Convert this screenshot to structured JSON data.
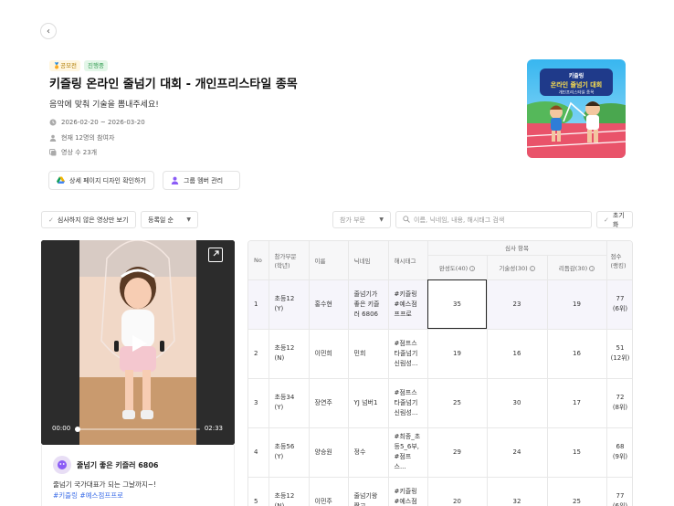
{
  "header": {
    "badges": [
      "공모전",
      "진행중"
    ],
    "title": "키즐링 온라인 줄넘기 대회 - 개인프리스타일 종목",
    "subtitle": "음악에 맞춰 기술을 뽐내주세요!",
    "period": "2026-02-20 ~ 2026-03-20",
    "participants": "현재 12명의 참여자",
    "video_count": "영상 수 23개",
    "btn_design": "상세 페이지 디자인 확인하기",
    "btn_group": "그룹 멤버 관리"
  },
  "thumbnail": {
    "line1": "키즐링",
    "line2": "온라인 줄넘기 대회",
    "line3": "개인프리스타일 종목"
  },
  "filters": {
    "unviewed": "심사하지 않은 영상만 보기",
    "sort": "등록일 순",
    "category": "참가 부문",
    "search_placeholder": "이름, 닉네임, 내용, 해시태그 검색",
    "reset": "초기화"
  },
  "player": {
    "current_time": "00:00",
    "duration": "02:33",
    "progress": 0
  },
  "video_card": {
    "name": "줄넘기 좋은 키즐러 6806",
    "description": "줄넘기 국가대표가 되는 그날까지~!",
    "tags": "#키즐링 #예스점프프로"
  },
  "table": {
    "headers": {
      "no": "No",
      "category": [
        "참가부문",
        "(학년)"
      ],
      "name": "이름",
      "nickname": "닉네임",
      "hashtag": "해시태그",
      "criteria_group": "심사 항목",
      "criteria": [
        "완성도(40)",
        "기술성(30)",
        "리듬감(30)"
      ],
      "score": [
        "점수",
        "(랭킹)"
      ]
    },
    "rows": [
      {
        "no": "1",
        "category": [
          "초등12",
          "(Y)"
        ],
        "name": "홍수현",
        "nickname": [
          "줄넘기가",
          "좋은 키즐",
          "러 6806"
        ],
        "hashtag": [
          "#키즐링",
          "#예스점",
          "프프로"
        ],
        "s1": "35",
        "s2": "23",
        "s3": "19",
        "score": [
          "77",
          "(6위)"
        ]
      },
      {
        "no": "2",
        "category": [
          "초등12",
          "(N)"
        ],
        "name": "이민희",
        "nickname": [
          "민희"
        ],
        "hashtag": [
          "#점프스",
          "타줄넘기",
          "신림성..."
        ],
        "s1": "19",
        "s2": "16",
        "s3": "16",
        "score": [
          "51",
          "(12위)"
        ]
      },
      {
        "no": "3",
        "category": [
          "초등34",
          "(Y)"
        ],
        "name": "장연주",
        "nickname": [
          "YJ 넘버1"
        ],
        "hashtag": [
          "#점프스",
          "타줄넘기",
          "신림성..."
        ],
        "s1": "25",
        "s2": "30",
        "s3": "17",
        "score": [
          "72",
          "(8위)"
        ]
      },
      {
        "no": "4",
        "category": [
          "초등56",
          "(Y)"
        ],
        "name": "양승원",
        "nickname": [
          "정수"
        ],
        "hashtag": [
          "#최종_초",
          "등5_6부,",
          "#점프스..."
        ],
        "s1": "29",
        "s2": "24",
        "s3": "15",
        "score": [
          "68",
          "(9위)"
        ]
      },
      {
        "no": "5",
        "category": [
          "초등12",
          "(N)"
        ],
        "name": "이민주",
        "nickname": [
          "줄넘기왕",
          "짱고"
        ],
        "hashtag": [
          "#키즐링",
          "#예스점",
          "..."
        ],
        "s1": "20",
        "s2": "32",
        "s3": "25",
        "score": [
          "77",
          "(6위)"
        ]
      }
    ]
  }
}
